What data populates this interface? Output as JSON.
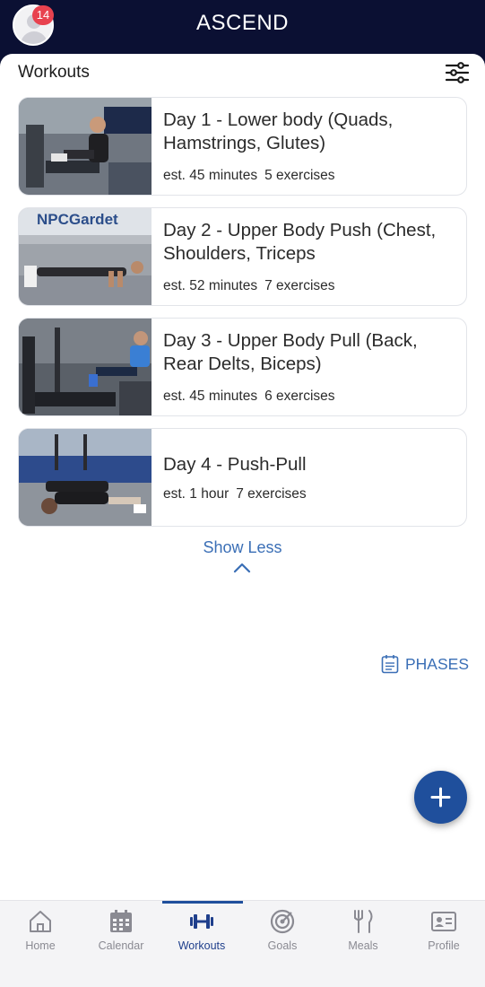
{
  "header": {
    "app_name": "ASCEND",
    "notification_count": "14"
  },
  "workouts": {
    "title": "Workouts",
    "items": [
      {
        "title": "Day 1 - Lower body (Quads, Hamstrings, Glutes)",
        "duration": "est. 45 minutes",
        "exercises": "5 exercises"
      },
      {
        "title": "Day 2 - Upper Body Push (Chest, Shoulders, Triceps",
        "duration": "est. 52 minutes",
        "exercises": "7 exercises",
        "thumb_sign_text": "NPCGardet"
      },
      {
        "title": "Day 3 - Upper Body Pull (Back, Rear Delts, Biceps)",
        "duration": "est. 45 minutes",
        "exercises": "6 exercises"
      },
      {
        "title": "Day 4 - Push-Pull",
        "duration": "est. 1 hour",
        "exercises": "7 exercises"
      }
    ],
    "show_less_label": "Show Less"
  },
  "phases_label": "PHASES",
  "tabs": [
    {
      "label": "Home",
      "icon": "home-icon"
    },
    {
      "label": "Calendar",
      "icon": "calendar-icon"
    },
    {
      "label": "Workouts",
      "icon": "dumbbell-icon",
      "active": true
    },
    {
      "label": "Goals",
      "icon": "target-icon"
    },
    {
      "label": "Meals",
      "icon": "fork-knife-icon"
    },
    {
      "label": "Profile",
      "icon": "profile-card-icon"
    }
  ],
  "colors": {
    "header_bg": "#0b1033",
    "accent": "#1f4f9c",
    "link": "#3b6fb6",
    "badge": "#e8424f"
  }
}
